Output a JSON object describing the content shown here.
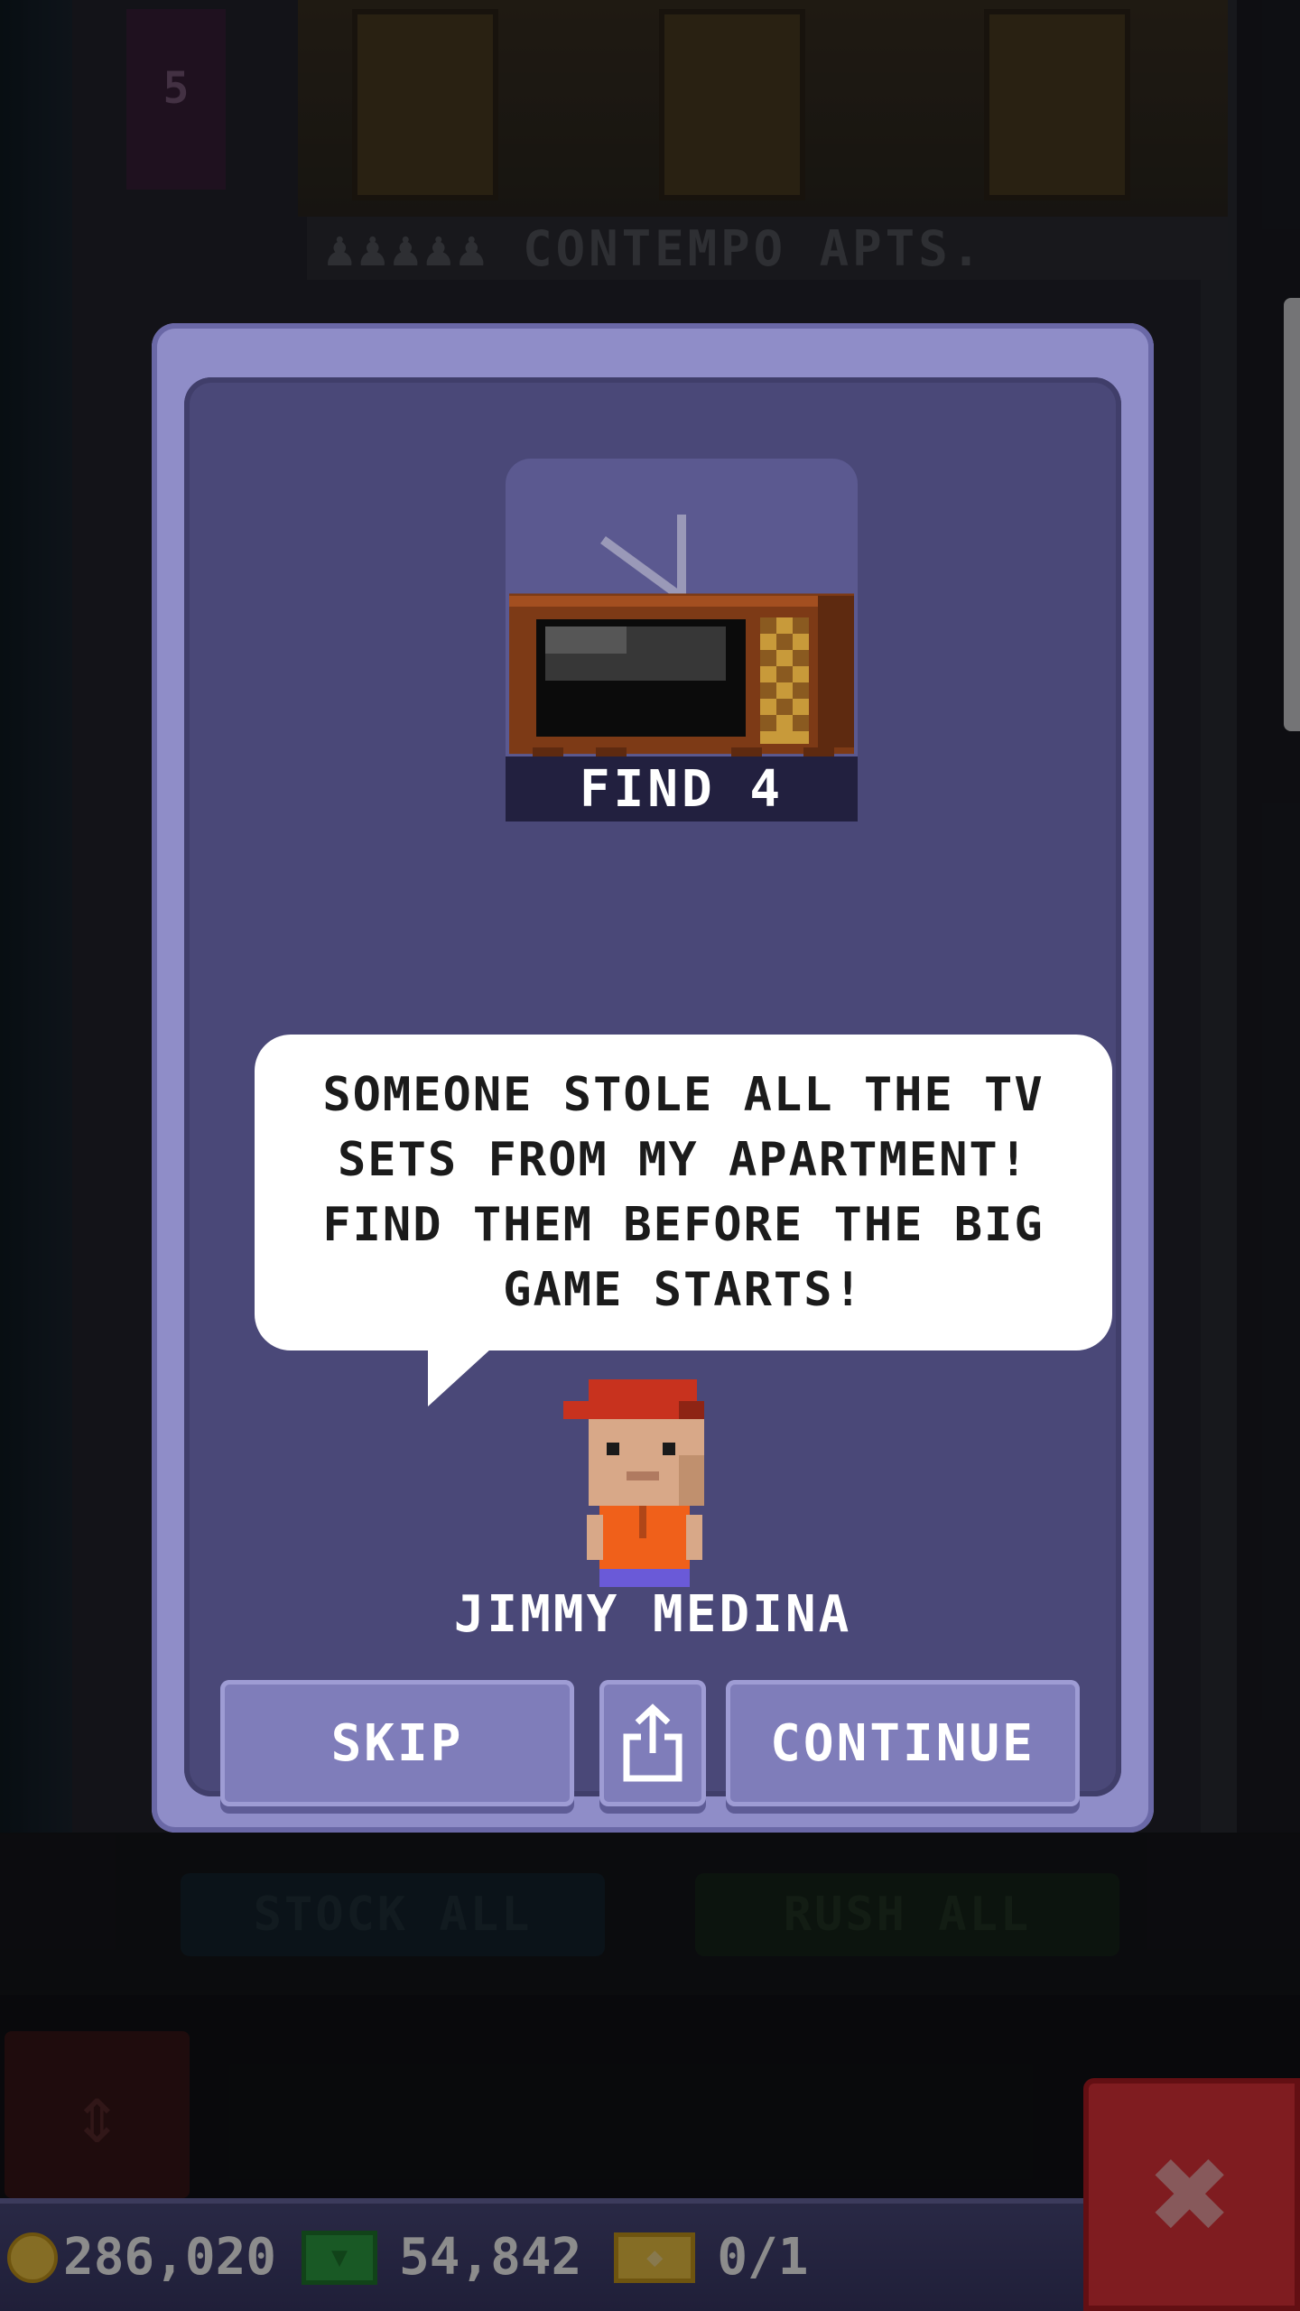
{
  "background": {
    "floor_sign": "♟♟♟♟♟ CONTEMPO APTS.",
    "left_door_number": "5",
    "stock_all_label": "STOCK ALL",
    "rush_all_label": "RUSH ALL"
  },
  "mission": {
    "title": "FIND 4",
    "item_icon": "tv-icon",
    "dialogue": "SOMEONE STOLE ALL THE TV SETS FROM MY APARTMENT! FIND THEM BEFORE THE BIG GAME STARTS!",
    "character_name": "JIMMY MEDINA"
  },
  "buttons": {
    "skip": "SKIP",
    "share_icon": "share-icon",
    "continue": "CONTINUE"
  },
  "status": {
    "coins": "286,020",
    "bux": "54,842",
    "tickets": "0/1"
  },
  "colors": {
    "dialog_outer": "#8f8dc8",
    "dialog_inner": "#4a4878",
    "button": "#7f7dba",
    "close_button": "#e8333b"
  }
}
